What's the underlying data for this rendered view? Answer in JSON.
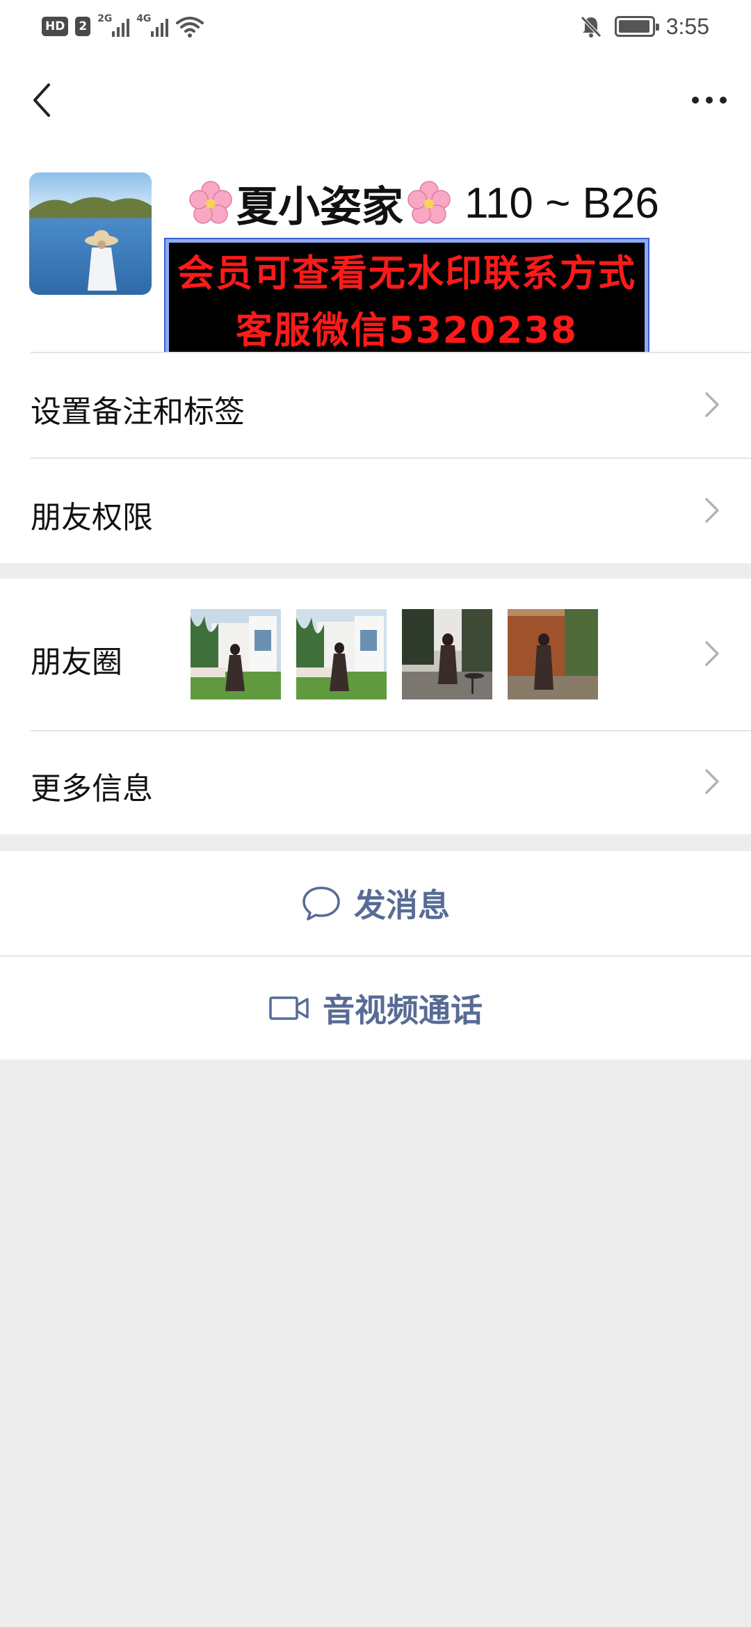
{
  "status_bar": {
    "hd_label": "HD",
    "sim_label": "2",
    "net1_label": "2G",
    "net2_label": "4G",
    "time": "3:55"
  },
  "profile": {
    "name": "夏小姿家",
    "name_code": "110 ~ B26",
    "watermark_line1": "会员可查看无水印联系方式",
    "watermark_line2": "客服微信5320238"
  },
  "rows": {
    "remark_label": "设置备注和标签",
    "permissions_label": "朋友权限",
    "moments_label": "朋友圈",
    "more_info_label": "更多信息"
  },
  "actions": {
    "message_label": "发消息",
    "call_label": "音视频通话"
  },
  "colors": {
    "link": "#576b95",
    "background": "#ededed",
    "watermark_text": "#ff1a1a"
  },
  "icons": {
    "back": "chevron-left-icon",
    "more": "more-dots-icon",
    "message": "chat-bubble-icon",
    "call": "video-camera-icon",
    "row_arrow": "chevron-right-icon"
  }
}
